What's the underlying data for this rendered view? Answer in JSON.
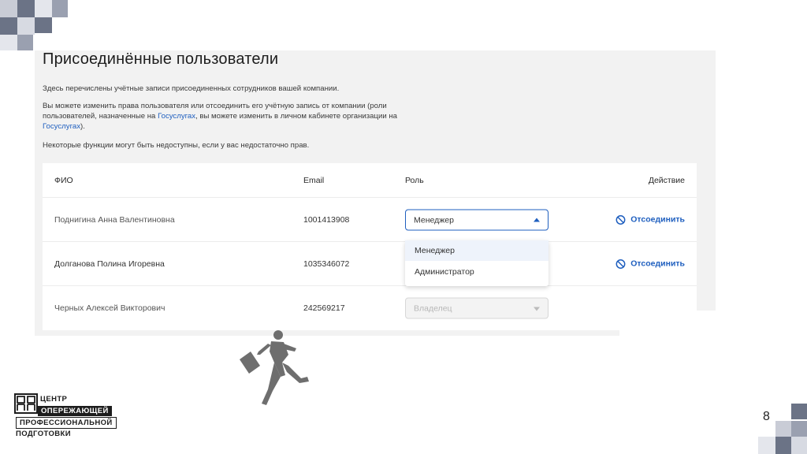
{
  "page": {
    "heading": "Присоединённые пользователи",
    "intro": "Здесь перечислены учётные записи присоединенных сотрудников вашей компании.",
    "rights_line1": "Вы можете изменить права пользователя или отсоединить его учётную запись от компании (роли",
    "rights_line2_pre": "пользователей, назначенные на ",
    "rights_link1": "Госуслугах",
    "rights_line2_post": ", вы можете изменить в личном кабинете организации на",
    "rights_link2": "Госуслугах",
    "rights_line3_post": ").",
    "warning": "Некоторые функции могут быть недоступны, если у вас недостаточно прав.",
    "page_number": "8"
  },
  "table": {
    "columns": {
      "fio": "ФИО",
      "email": "Email",
      "role": "Роль",
      "action": "Действие"
    },
    "rows": [
      {
        "fio": "Поднигина Анна Валентиновна",
        "email": "1001413908",
        "role": "Менеджер",
        "action": "Отсоединить"
      },
      {
        "fio": "Долганова Полина Игоревна",
        "email": "1035346072",
        "role": "",
        "action": "Отсоединить"
      },
      {
        "fio": "Черных Алексей Викторович",
        "email": "242569217",
        "role": "Владелец",
        "action": ""
      }
    ]
  },
  "dropdown": {
    "options": [
      "Менеджер",
      "Администратор"
    ]
  },
  "logo": {
    "line1": "ЦЕНТР",
    "line2": "ОПЕРЕЖАЮЩЕЙ",
    "line3": "ПРОФЕССИОНАЛЬНОЙ",
    "line4": "ПОДГОТОВКИ"
  },
  "colors": {
    "accent": "#1f5fbf",
    "panel": "#f2f2f2",
    "squares_dark": "#6b7386",
    "squares_light": "#c9ccd6"
  }
}
